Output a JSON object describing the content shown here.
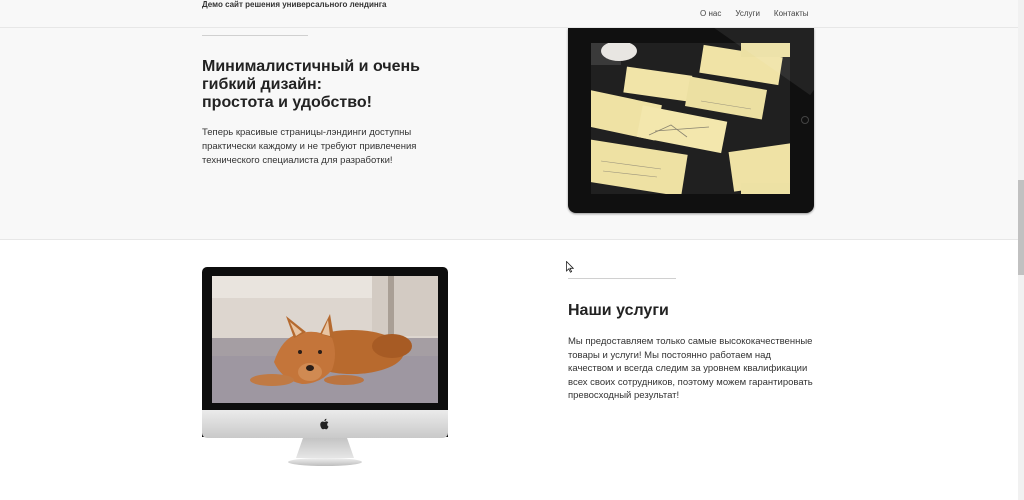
{
  "navbar": {
    "brand": "Демо сайт решения универсального лендинга",
    "links": [
      "О нас",
      "Услуги",
      "Контакты"
    ]
  },
  "feature": {
    "heading_lines": [
      "Минималистичный и очень",
      "гибкий дизайн:",
      "простота и удобство!"
    ],
    "text": "Теперь красивые страницы-лэндинги доступны практически каждому и не требуют привлечения технического специалиста для разработки!"
  },
  "services": {
    "heading": "Наши услуги",
    "text": "Мы предоставляем только самые высококачественные товары и услуги! Мы постоянно работаем над качеством и всегда следим за уровнем квалификации всех своих сотрудников, поэтому можем гарантировать превосходный результат!"
  },
  "colors": {
    "section_gray": "#f8f8f8",
    "divider": "#d0d0d0",
    "text": "#333333",
    "heading": "#222222",
    "sticky_note": "#efe2a4"
  },
  "icons": {
    "apple_logo": "apple-logo-icon",
    "cursor": "mouse-cursor-icon"
  }
}
